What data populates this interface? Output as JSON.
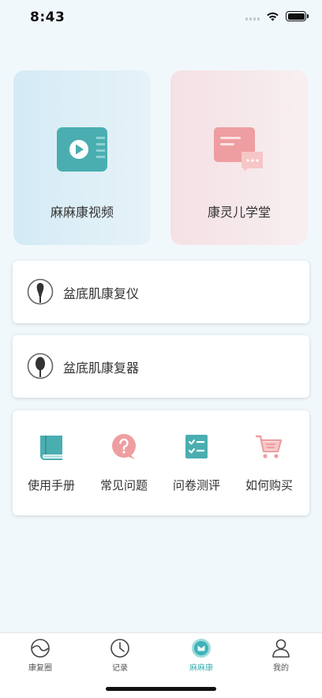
{
  "status_bar": {
    "time": "8:43"
  },
  "feature_cards": [
    {
      "label": "麻麻康视频",
      "icon": "video-play-icon",
      "bg_color": "#d4ebf5",
      "icon_color": "#4aaeb1"
    },
    {
      "label": "康灵儿学堂",
      "icon": "chat-bubble-icon",
      "bg_color": "#f4e1e4",
      "icon_color": "#ee9ea0"
    }
  ],
  "devices": [
    {
      "label": "盆底肌康复仪",
      "icon": "probe-icon"
    },
    {
      "label": "盆底肌康复器",
      "icon": "trainer-icon"
    }
  ],
  "tools": [
    {
      "label": "使用手册",
      "icon": "book-icon",
      "color": "#4aaeb1"
    },
    {
      "label": "常见问题",
      "icon": "question-icon",
      "color": "#ee9ea0"
    },
    {
      "label": "问卷测评",
      "icon": "checklist-icon",
      "color": "#4aaeb1"
    },
    {
      "label": "如何购买",
      "icon": "cart-icon",
      "color": "#ee9ea0"
    }
  ],
  "tab_bar": {
    "active_color": "#3db3b7",
    "tabs": [
      {
        "label": "康复圈",
        "icon": "circle-community-icon",
        "active": false
      },
      {
        "label": "记录",
        "icon": "clock-icon",
        "active": false
      },
      {
        "label": "麻麻康",
        "icon": "home-logo-icon",
        "active": true
      },
      {
        "label": "我的",
        "icon": "person-icon",
        "active": false
      }
    ]
  }
}
